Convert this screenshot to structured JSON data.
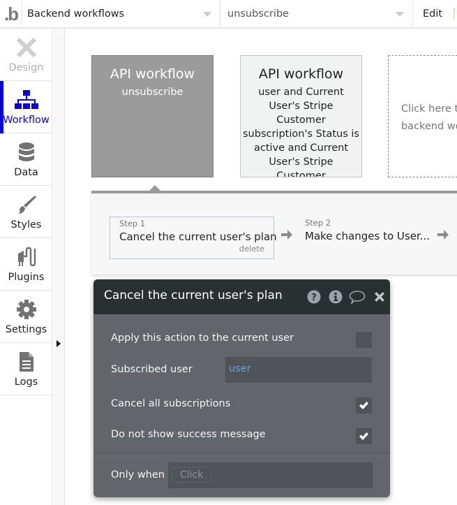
{
  "topbar": {
    "logo": ".b",
    "page_selector": {
      "value": "Backend workflows"
    },
    "workflow_selector": {
      "value": "unsubscribe"
    },
    "edit_menu": "Edit"
  },
  "sidebar": {
    "items": [
      {
        "id": "design",
        "label": "Design",
        "icon": "design-icon",
        "state": "disabled"
      },
      {
        "id": "workflow",
        "label": "Workflow",
        "icon": "workflow-icon",
        "state": "active"
      },
      {
        "id": "data",
        "label": "Data",
        "icon": "database-icon",
        "state": "normal"
      },
      {
        "id": "styles",
        "label": "Styles",
        "icon": "paintbrush-icon",
        "state": "normal"
      },
      {
        "id": "plugins",
        "label": "Plugins",
        "icon": "plug-icon",
        "state": "normal"
      },
      {
        "id": "settings",
        "label": "Settings",
        "icon": "gear-icon",
        "state": "normal"
      },
      {
        "id": "logs",
        "label": "Logs",
        "icon": "document-icon",
        "state": "normal"
      }
    ],
    "active_color": "#0e00d5"
  },
  "canvas": {
    "cards": [
      {
        "title": "API workflow",
        "subtitle": "unsubscribe",
        "selected": true
      },
      {
        "title": "API workflow",
        "subtitle": "user and Current User's Stripe Customer subscription's Status is active and Current User's Stripe Customer",
        "selected": false
      },
      {
        "hint": "Click here to add a backend workflow",
        "hint_visible": "Click here t\nbackend wo"
      }
    ],
    "steps": [
      {
        "number": "Step 1",
        "name": "Cancel the current user's plan",
        "delete_label": "delete"
      },
      {
        "number": "Step 2",
        "name": "Make changes to User..."
      }
    ]
  },
  "editor": {
    "title": "Cancel the current user's plan",
    "header_icons": [
      "help-icon",
      "info-icon",
      "comment-icon",
      "close-icon"
    ],
    "fields": {
      "apply_current_user": {
        "label": "Apply this action to the current user",
        "checked": false
      },
      "subscribed_user": {
        "label": "Subscribed user",
        "value": "user"
      },
      "cancel_all": {
        "label": "Cancel all subscriptions",
        "checked": true
      },
      "no_success_msg": {
        "label": "Do not show success message",
        "checked": true
      },
      "only_when": {
        "label": "Only when",
        "placeholder": "Click"
      }
    },
    "value_color": "#5ea4f0"
  }
}
